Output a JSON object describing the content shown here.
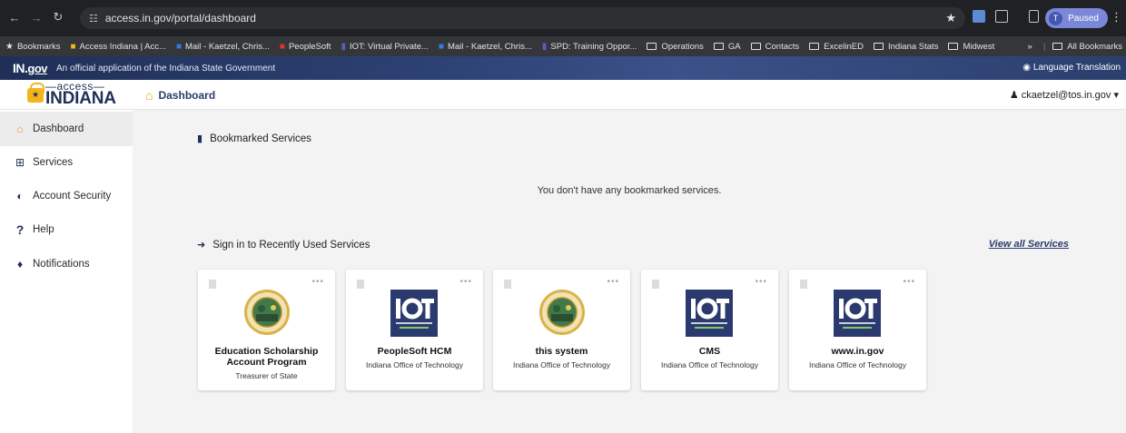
{
  "browser": {
    "url": "access.in.gov/portal/dashboard",
    "profile_initial": "T",
    "profile_label": "Paused",
    "bookmarks": [
      {
        "label": "Bookmarks",
        "icon": "star-icon"
      },
      {
        "label": "Access Indiana | Acc...",
        "icon": "lock-icon"
      },
      {
        "label": "Mail - Kaetzel, Chris...",
        "icon": "outlook-icon"
      },
      {
        "label": "PeopleSoft",
        "icon": "peoplesoft-icon"
      },
      {
        "label": "IOT: Virtual Private...",
        "icon": "bookmark-icon"
      },
      {
        "label": "Mail - Kaetzel, Chris...",
        "icon": "outlook-icon"
      },
      {
        "label": "SPD: Training Oppor...",
        "icon": "bookmark-icon"
      },
      {
        "label": "Operations",
        "icon": "folder-icon"
      },
      {
        "label": "GA",
        "icon": "folder-icon"
      },
      {
        "label": "Contacts",
        "icon": "folder-icon"
      },
      {
        "label": "ExcelinED",
        "icon": "folder-icon"
      },
      {
        "label": "Indiana Stats",
        "icon": "folder-icon"
      },
      {
        "label": "Midwest",
        "icon": "folder-icon"
      }
    ],
    "all_bookmarks": "All Bookmarks"
  },
  "ingov": {
    "logo_in": "IN.",
    "logo_gov": "gov",
    "text": "An official application of the Indiana State Government",
    "language": "Language Translation"
  },
  "header": {
    "logo_access": "—access—",
    "logo_indiana": "INDIANA",
    "breadcrumb": "Dashboard",
    "user": "ckaetzel@tos.in.gov"
  },
  "sidebar": {
    "items": [
      {
        "label": "Dashboard"
      },
      {
        "label": "Services"
      },
      {
        "label": "Account Security"
      },
      {
        "label": "Help"
      },
      {
        "label": "Notifications"
      }
    ]
  },
  "main": {
    "bookmarked_title": "Bookmarked Services",
    "empty_message": "You don't have any bookmarked services.",
    "recent_title": "Sign in to Recently Used Services",
    "view_all": "View all Services",
    "cards": [
      {
        "title1": "Education Scholarship",
        "title2": "Account Program",
        "sub": "Treasurer of State",
        "logo": "state-seal"
      },
      {
        "title1": "PeopleSoft HCM",
        "title2": "",
        "sub": "Indiana Office of Technology",
        "logo": "iot-logo"
      },
      {
        "title1": "this system",
        "title2": "",
        "sub": "Indiana Office of Technology",
        "logo": "state-seal"
      },
      {
        "title1": "CMS",
        "title2": "",
        "sub": "Indiana Office of Technology",
        "logo": "iot-logo"
      },
      {
        "title1": "www.in.gov",
        "title2": "",
        "sub": "Indiana Office of Technology",
        "logo": "iot-logo"
      }
    ]
  },
  "colors": {
    "navy": "#1f2f57",
    "gold": "#e8a317",
    "iot_blue": "#2b3a6e"
  }
}
